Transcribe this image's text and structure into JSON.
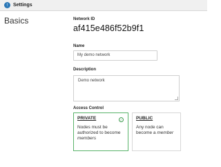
{
  "header": {
    "title": "Settings",
    "icon": "arrow-up-icon"
  },
  "section": {
    "title": "Basics"
  },
  "network_id": {
    "label": "Network ID",
    "value": "af415e486f52b9f1"
  },
  "name": {
    "label": "Name",
    "value": "My demo network"
  },
  "description": {
    "label": "Description",
    "value": "Demo network"
  },
  "access_control": {
    "label": "Access Control",
    "private": {
      "title": "PRIVATE",
      "desc_prefix": "Nodes must be authorized to become ",
      "desc_em": "members",
      "selected": true,
      "accent": "#59b36a"
    },
    "public": {
      "title": "PUBLIC",
      "desc_prefix": "Any node can become a ",
      "desc_em": "member",
      "selected": false
    }
  }
}
